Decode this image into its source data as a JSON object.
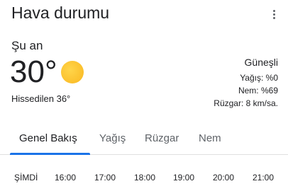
{
  "header": {
    "title": "Hava durumu",
    "menu_icon": "more-vert-icon"
  },
  "current": {
    "label": "Şu an",
    "temperature": "30°",
    "weather_icon": "sun-icon",
    "feels_like": "Hissedilen 36°",
    "condition": "Güneşli",
    "precipitation": "Yağış: %0",
    "humidity": "Nem: %69",
    "wind": "Rüzgar: 8 km/sa."
  },
  "tabs": [
    {
      "label": "Genel Bakış",
      "active": true
    },
    {
      "label": "Yağış",
      "active": false
    },
    {
      "label": "Rüzgar",
      "active": false
    },
    {
      "label": "Nem",
      "active": false
    }
  ],
  "hours": [
    "ŞİMDİ",
    "16:00",
    "17:00",
    "18:00",
    "19:00",
    "20:00",
    "21:00"
  ],
  "colors": {
    "accent": "#1a73e8",
    "sun": "#fbc02d"
  }
}
